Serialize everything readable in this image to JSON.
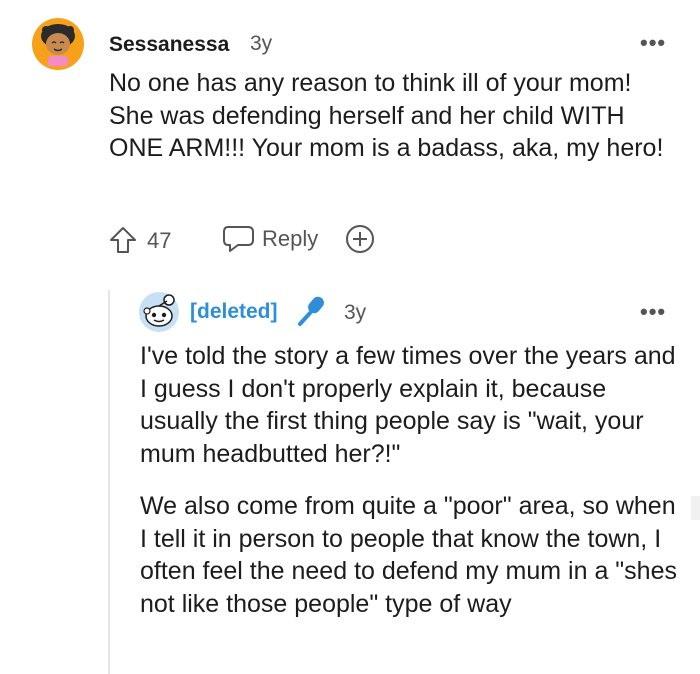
{
  "comment": {
    "author": "Sessanessa",
    "age": "3y",
    "more_label": "•••",
    "paragraphs": [
      "No one has any reason to think ill of your mom! She was defending herself and her child WITH ONE ARM!!! Your mom is a badass, aka, my hero!"
    ],
    "votes": "47",
    "reply_label": "Reply"
  },
  "reply": {
    "author": "[deleted]",
    "age": "3y",
    "more_label": "•••",
    "paragraphs": [
      "I've told the story a few times over the years and I guess I don't properly explain it, because usually the first thing people say is \"wait, your mum headbutted her?!\"",
      "We also come from quite a \"poor\" area, so when I tell it in person to people that know the town, I often feel the need to defend my mum in a \"shes not like those people\" type of way"
    ]
  },
  "colors": {
    "text": "#1c1c1c",
    "meta": "#555555",
    "deleted_accent": "#2e8fd8",
    "avatar_orange": "#f7a11a",
    "thread_line": "#e6e6e6"
  },
  "icons": {
    "upvote": "upvote-arrow-icon",
    "reply": "speech-bubble-icon",
    "award": "plus-circle-icon",
    "mic": "microphone-icon"
  }
}
